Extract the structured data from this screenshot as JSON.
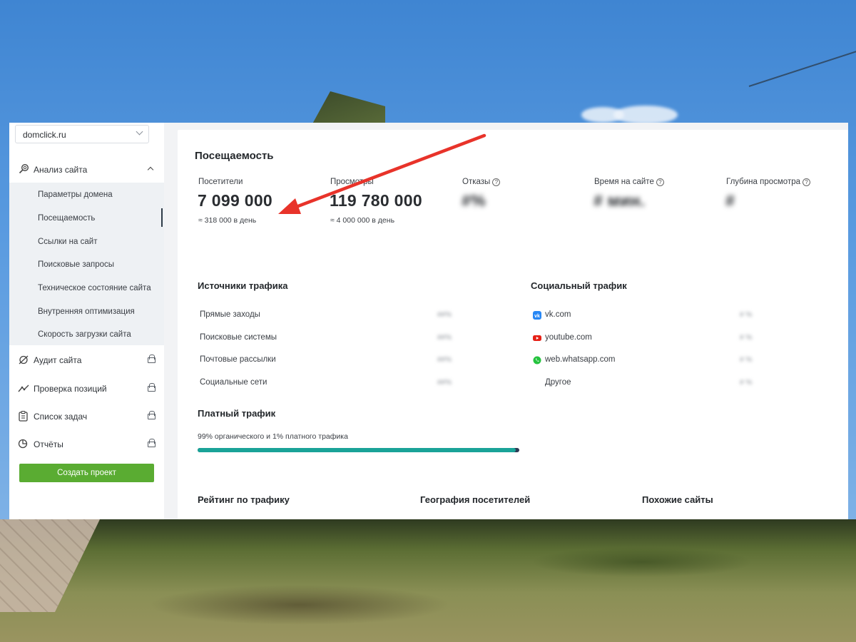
{
  "sidebar": {
    "domain": "domclick.ru",
    "analysis": {
      "label": "Анализ сайта",
      "items": [
        {
          "label": "Параметры домена"
        },
        {
          "label": "Посещаемость"
        },
        {
          "label": "Ссылки на сайт"
        },
        {
          "label": "Поисковые запросы"
        },
        {
          "label": "Техническое состояние сайта"
        },
        {
          "label": "Внутренняя оптимизация"
        },
        {
          "label": "Скорость загрузки сайта"
        }
      ]
    },
    "locked_items": [
      {
        "label": "Аудит сайта"
      },
      {
        "label": "Проверка позиций"
      },
      {
        "label": "Список задач"
      },
      {
        "label": "Отчёты"
      }
    ],
    "create_button": "Создать проект"
  },
  "traffic": {
    "title": "Посещаемость",
    "metrics": [
      {
        "label": "Посетители",
        "value": "7 099 000",
        "sub": "≈ 318 000 в день"
      },
      {
        "label": "Просмотры",
        "value": "119 780 000",
        "sub": "≈ 4 000 000 в день"
      },
      {
        "label": "Отказы",
        "value": "#%"
      },
      {
        "label": "Время на сайте",
        "value": "# мин."
      },
      {
        "label": "Глубина просмотра",
        "value": "#"
      }
    ],
    "help_glyph": "?"
  },
  "sources": {
    "title": "Источники трафика",
    "rows": [
      {
        "label": "Прямые заходы",
        "value": "##%"
      },
      {
        "label": "Поисковые системы",
        "value": "##%"
      },
      {
        "label": "Почтовые рассылки",
        "value": "##%"
      },
      {
        "label": "Социальные сети",
        "value": "##%"
      }
    ]
  },
  "social": {
    "title": "Социальный трафик",
    "rows": [
      {
        "label": "vk.com",
        "value": "# %",
        "icon": "vk-icon",
        "color": "#2787f5"
      },
      {
        "label": "youtube.com",
        "value": "# %",
        "icon": "youtube-icon",
        "color": "#e62117"
      },
      {
        "label": "web.whatsapp.com",
        "value": "# %",
        "icon": "whatsapp-icon",
        "color": "#25c33e"
      },
      {
        "label": "Другое",
        "value": "# %"
      }
    ]
  },
  "paid": {
    "title": "Платный трафик",
    "caption": "99% органического и 1% платного трафика",
    "organic_fraction": 0.99,
    "colors": {
      "organic": "#1aa398",
      "paid": "#2d3a55"
    }
  },
  "bottom_sections": [
    "Рейтинг по трафику",
    "География посетителей",
    "Похожие сайты"
  ],
  "accent": {
    "green": "#5aac32",
    "annotation_arrow": "#e8332a"
  }
}
